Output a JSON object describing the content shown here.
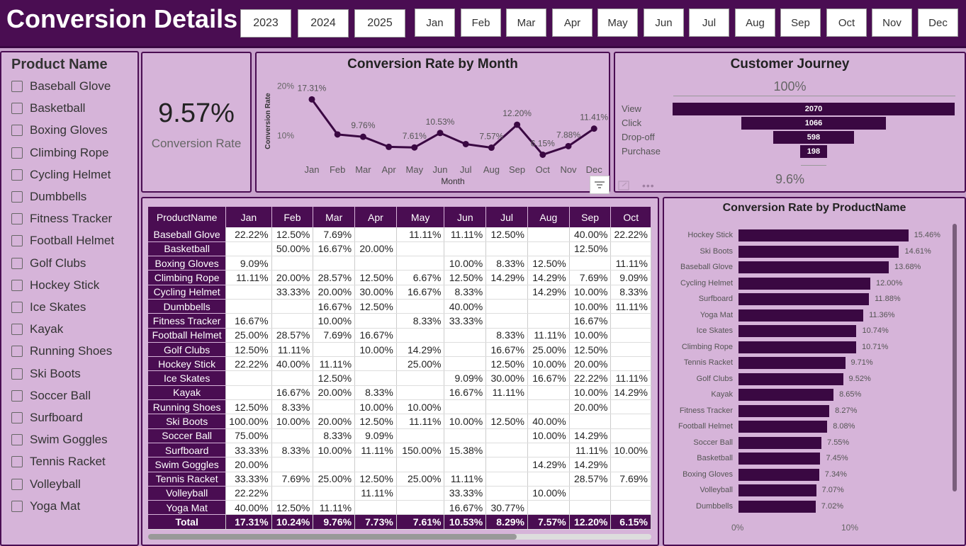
{
  "header": {
    "title": "Conversion Details",
    "years": [
      "2023",
      "2024",
      "2025"
    ],
    "months": [
      "Jan",
      "Feb",
      "Mar",
      "Apr",
      "May",
      "Jun",
      "Jul",
      "Aug",
      "Sep",
      "Oct",
      "Nov",
      "Dec"
    ]
  },
  "product_slicer": {
    "title": "Product Name",
    "items": [
      "Baseball Glove",
      "Basketball",
      "Boxing Gloves",
      "Climbing Rope",
      "Cycling Helmet",
      "Dumbbells",
      "Fitness Tracker",
      "Football Helmet",
      "Golf Clubs",
      "Hockey Stick",
      "Ice Skates",
      "Kayak",
      "Running Shoes",
      "Ski Boots",
      "Soccer Ball",
      "Surfboard",
      "Swim Goggles",
      "Tennis Racket",
      "Volleyball",
      "Yoga Mat"
    ]
  },
  "kpi": {
    "value": "9.57%",
    "label": "Conversion Rate"
  },
  "funnel": {
    "title": "Customer Journey",
    "top_label": "100%",
    "bottom_label": "9.6%",
    "stages": [
      {
        "label": "View",
        "value": 2070,
        "text": "2070"
      },
      {
        "label": "Click",
        "value": 1066,
        "text": "1066"
      },
      {
        "label": "Drop-off",
        "value": 598,
        "text": "598"
      },
      {
        "label": "Purchase",
        "value": 198,
        "text": "198"
      }
    ]
  },
  "matrix": {
    "columns": [
      "ProductName",
      "Jan",
      "Feb",
      "Mar",
      "Apr",
      "May",
      "Jun",
      "Jul",
      "Aug",
      "Sep",
      "Oct"
    ],
    "rows": [
      [
        "Baseball Glove",
        "22.22%",
        "12.50%",
        "7.69%",
        "",
        "11.11%",
        "11.11%",
        "12.50%",
        "",
        "40.00%",
        "22.22%"
      ],
      [
        "Basketball",
        "",
        "50.00%",
        "16.67%",
        "20.00%",
        "",
        "",
        "",
        "",
        "12.50%",
        ""
      ],
      [
        "Boxing Gloves",
        "9.09%",
        "",
        "",
        "",
        "",
        "10.00%",
        "8.33%",
        "12.50%",
        "",
        "11.11%"
      ],
      [
        "Climbing Rope",
        "11.11%",
        "20.00%",
        "28.57%",
        "12.50%",
        "6.67%",
        "12.50%",
        "14.29%",
        "14.29%",
        "7.69%",
        "9.09%"
      ],
      [
        "Cycling Helmet",
        "",
        "33.33%",
        "20.00%",
        "30.00%",
        "16.67%",
        "8.33%",
        "",
        "14.29%",
        "10.00%",
        "8.33%"
      ],
      [
        "Dumbbells",
        "",
        "",
        "16.67%",
        "12.50%",
        "",
        "40.00%",
        "",
        "",
        "10.00%",
        "11.11%"
      ],
      [
        "Fitness Tracker",
        "16.67%",
        "",
        "10.00%",
        "",
        "8.33%",
        "33.33%",
        "",
        "",
        "16.67%",
        ""
      ],
      [
        "Football Helmet",
        "25.00%",
        "28.57%",
        "7.69%",
        "16.67%",
        "",
        "",
        "8.33%",
        "11.11%",
        "10.00%",
        ""
      ],
      [
        "Golf Clubs",
        "12.50%",
        "11.11%",
        "",
        "10.00%",
        "14.29%",
        "",
        "16.67%",
        "25.00%",
        "12.50%",
        ""
      ],
      [
        "Hockey Stick",
        "22.22%",
        "40.00%",
        "11.11%",
        "",
        "25.00%",
        "",
        "12.50%",
        "10.00%",
        "20.00%",
        ""
      ],
      [
        "Ice Skates",
        "",
        "",
        "12.50%",
        "",
        "",
        "9.09%",
        "30.00%",
        "16.67%",
        "22.22%",
        "11.11%"
      ],
      [
        "Kayak",
        "",
        "16.67%",
        "20.00%",
        "8.33%",
        "",
        "16.67%",
        "11.11%",
        "",
        "10.00%",
        "14.29%"
      ],
      [
        "Running Shoes",
        "12.50%",
        "8.33%",
        "",
        "10.00%",
        "10.00%",
        "",
        "",
        "",
        "20.00%",
        ""
      ],
      [
        "Ski Boots",
        "100.00%",
        "10.00%",
        "20.00%",
        "12.50%",
        "11.11%",
        "10.00%",
        "12.50%",
        "40.00%",
        "",
        ""
      ],
      [
        "Soccer Ball",
        "75.00%",
        "",
        "8.33%",
        "9.09%",
        "",
        "",
        "",
        "10.00%",
        "14.29%",
        ""
      ],
      [
        "Surfboard",
        "33.33%",
        "8.33%",
        "10.00%",
        "11.11%",
        "150.00%",
        "15.38%",
        "",
        "",
        "11.11%",
        "10.00%"
      ],
      [
        "Swim Goggles",
        "20.00%",
        "",
        "",
        "",
        "",
        "",
        "",
        "14.29%",
        "14.29%",
        ""
      ],
      [
        "Tennis Racket",
        "33.33%",
        "7.69%",
        "25.00%",
        "12.50%",
        "25.00%",
        "11.11%",
        "",
        "",
        "28.57%",
        "7.69%"
      ],
      [
        "Volleyball",
        "22.22%",
        "",
        "",
        "11.11%",
        "",
        "33.33%",
        "",
        "10.00%",
        "",
        ""
      ],
      [
        "Yoga Mat",
        "40.00%",
        "12.50%",
        "11.11%",
        "",
        "",
        "16.67%",
        "30.77%",
        "",
        "",
        ""
      ]
    ],
    "total": [
      "Total",
      "17.31%",
      "10.24%",
      "9.76%",
      "7.73%",
      "7.61%",
      "10.53%",
      "8.29%",
      "7.57%",
      "12.20%",
      "6.15%"
    ]
  },
  "chart_data": [
    {
      "type": "line",
      "title": "Conversion Rate by Month",
      "xlabel": "Month",
      "ylabel": "Conversion Rate",
      "yticks": [
        "20%",
        "10%"
      ],
      "ylim": [
        0,
        20
      ],
      "categories": [
        "Jan",
        "Feb",
        "Mar",
        "Apr",
        "May",
        "Jun",
        "Jul",
        "Aug",
        "Sep",
        "Oct",
        "Nov",
        "Dec"
      ],
      "values": [
        17.31,
        10.24,
        9.76,
        7.73,
        7.61,
        10.53,
        8.29,
        7.57,
        12.2,
        6.15,
        7.88,
        11.41
      ],
      "data_labels": [
        "17.31%",
        "",
        "9.76%",
        "",
        "7.61%",
        "10.53%",
        "",
        "7.57%",
        "12.20%",
        "6.15%",
        "7.88%",
        "11.41%"
      ],
      "color": "#3a0842"
    },
    {
      "type": "bar",
      "orientation": "horizontal",
      "title": "Conversion Rate by ProductName",
      "xticks": [
        "0%",
        "10%"
      ],
      "xlim": [
        0,
        20
      ],
      "categories": [
        "Hockey Stick",
        "Ski Boots",
        "Baseball Glove",
        "Cycling Helmet",
        "Surfboard",
        "Yoga Mat",
        "Ice Skates",
        "Climbing Rope",
        "Tennis Racket",
        "Golf Clubs",
        "Kayak",
        "Fitness Tracker",
        "Football Helmet",
        "Soccer Ball",
        "Basketball",
        "Boxing Gloves",
        "Volleyball",
        "Dumbbells"
      ],
      "values": [
        15.46,
        14.61,
        13.68,
        12.0,
        11.88,
        11.36,
        10.74,
        10.71,
        9.71,
        9.52,
        8.65,
        8.27,
        8.08,
        7.55,
        7.45,
        7.34,
        7.07,
        7.02
      ],
      "labels": [
        "15.46%",
        "14.61%",
        "13.68%",
        "12.00%",
        "11.88%",
        "11.36%",
        "10.74%",
        "10.71%",
        "9.71%",
        "9.52%",
        "8.65%",
        "8.27%",
        "8.08%",
        "7.55%",
        "7.45%",
        "7.34%",
        "7.07%",
        "7.02%"
      ],
      "color": "#3a0842"
    }
  ]
}
